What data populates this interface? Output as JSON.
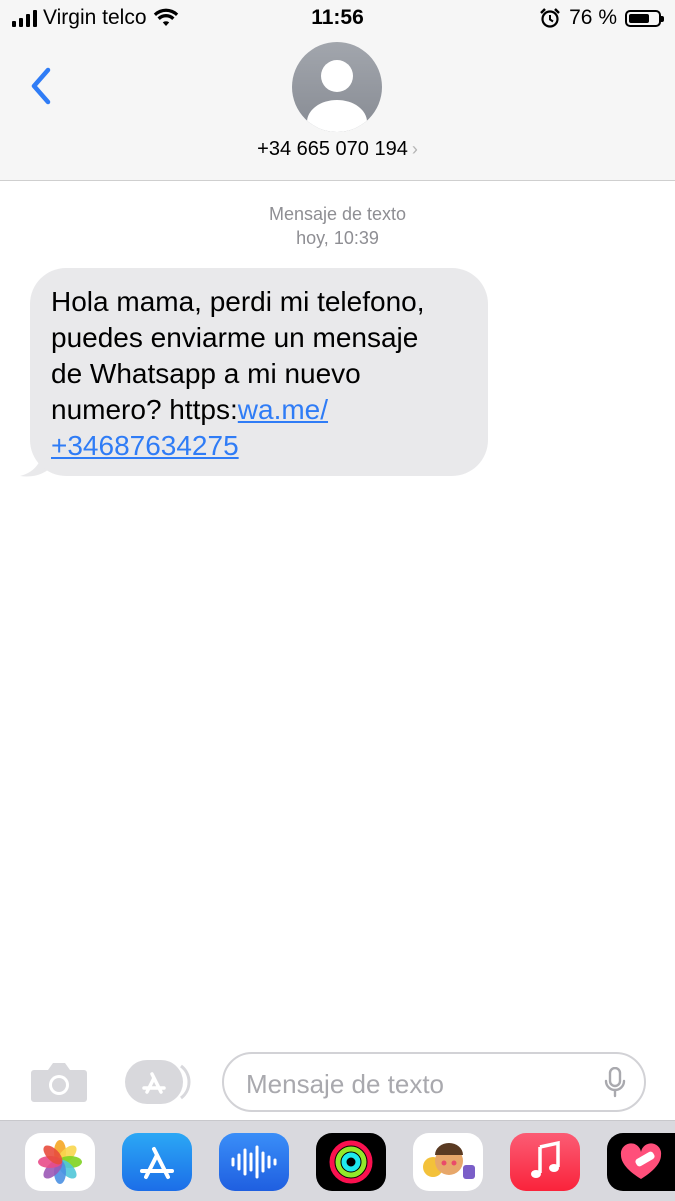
{
  "status_bar": {
    "carrier": "Virgin telco",
    "time": "11:56",
    "battery_text": "76 %",
    "battery_level": 0.76
  },
  "header": {
    "contact": "+34 665 070 194",
    "back_icon": "chevron-left-icon",
    "avatar_icon": "person-silhouette-icon"
  },
  "conversation": {
    "service_label": "Mensaje de texto",
    "timestamp": "hoy, 10:39",
    "messages": [
      {
        "direction": "incoming",
        "text": "Hola mama, perdi mi telefono, puedes enviarme un mensaje de Whatsapp a mi nuevo numero? https:",
        "link_part1": "wa.me/",
        "link_part2": "+34687634275",
        "line1": "Hola mama, perdi mi telefono,",
        "line2": "puedes enviarme un mensaje",
        "line3": "de Whatsapp a mi nuevo",
        "line4_prefix": "numero? https:"
      }
    ]
  },
  "composer": {
    "placeholder": "Mensaje de texto",
    "camera_icon": "camera-icon",
    "apps_icon": "app-store-icon",
    "mic_icon": "microphone-icon"
  },
  "app_drawer": {
    "apps": [
      "photos-icon",
      "app-store-icon",
      "audio-message-icon",
      "activity-icon",
      "memoji-icon",
      "music-icon",
      "heart-sticker-icon"
    ]
  },
  "colors": {
    "accent": "#2f7cf6",
    "bubble_incoming": "#e9e9eb",
    "header_bg": "#f6f6f6",
    "meta_text": "#8e8e93"
  }
}
